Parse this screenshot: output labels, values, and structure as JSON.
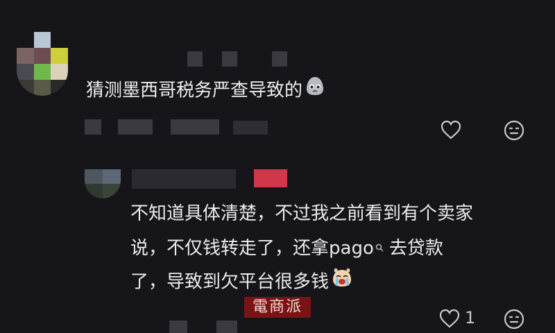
{
  "comment1": {
    "text": "猜测墨西哥税务严查导致的",
    "emoji": "pleading-face"
  },
  "reply1": {
    "line1": "不知道具体清楚，不过我之前看到有个卖家",
    "line2_pre": "说，不仅钱转走了，还拿",
    "line2_link": "pago",
    "line2_post": "去贷款",
    "line3": "了，导致到欠平台很多钱",
    "emoji": "crying-face",
    "like_count": "1"
  },
  "watermark": "電商派"
}
